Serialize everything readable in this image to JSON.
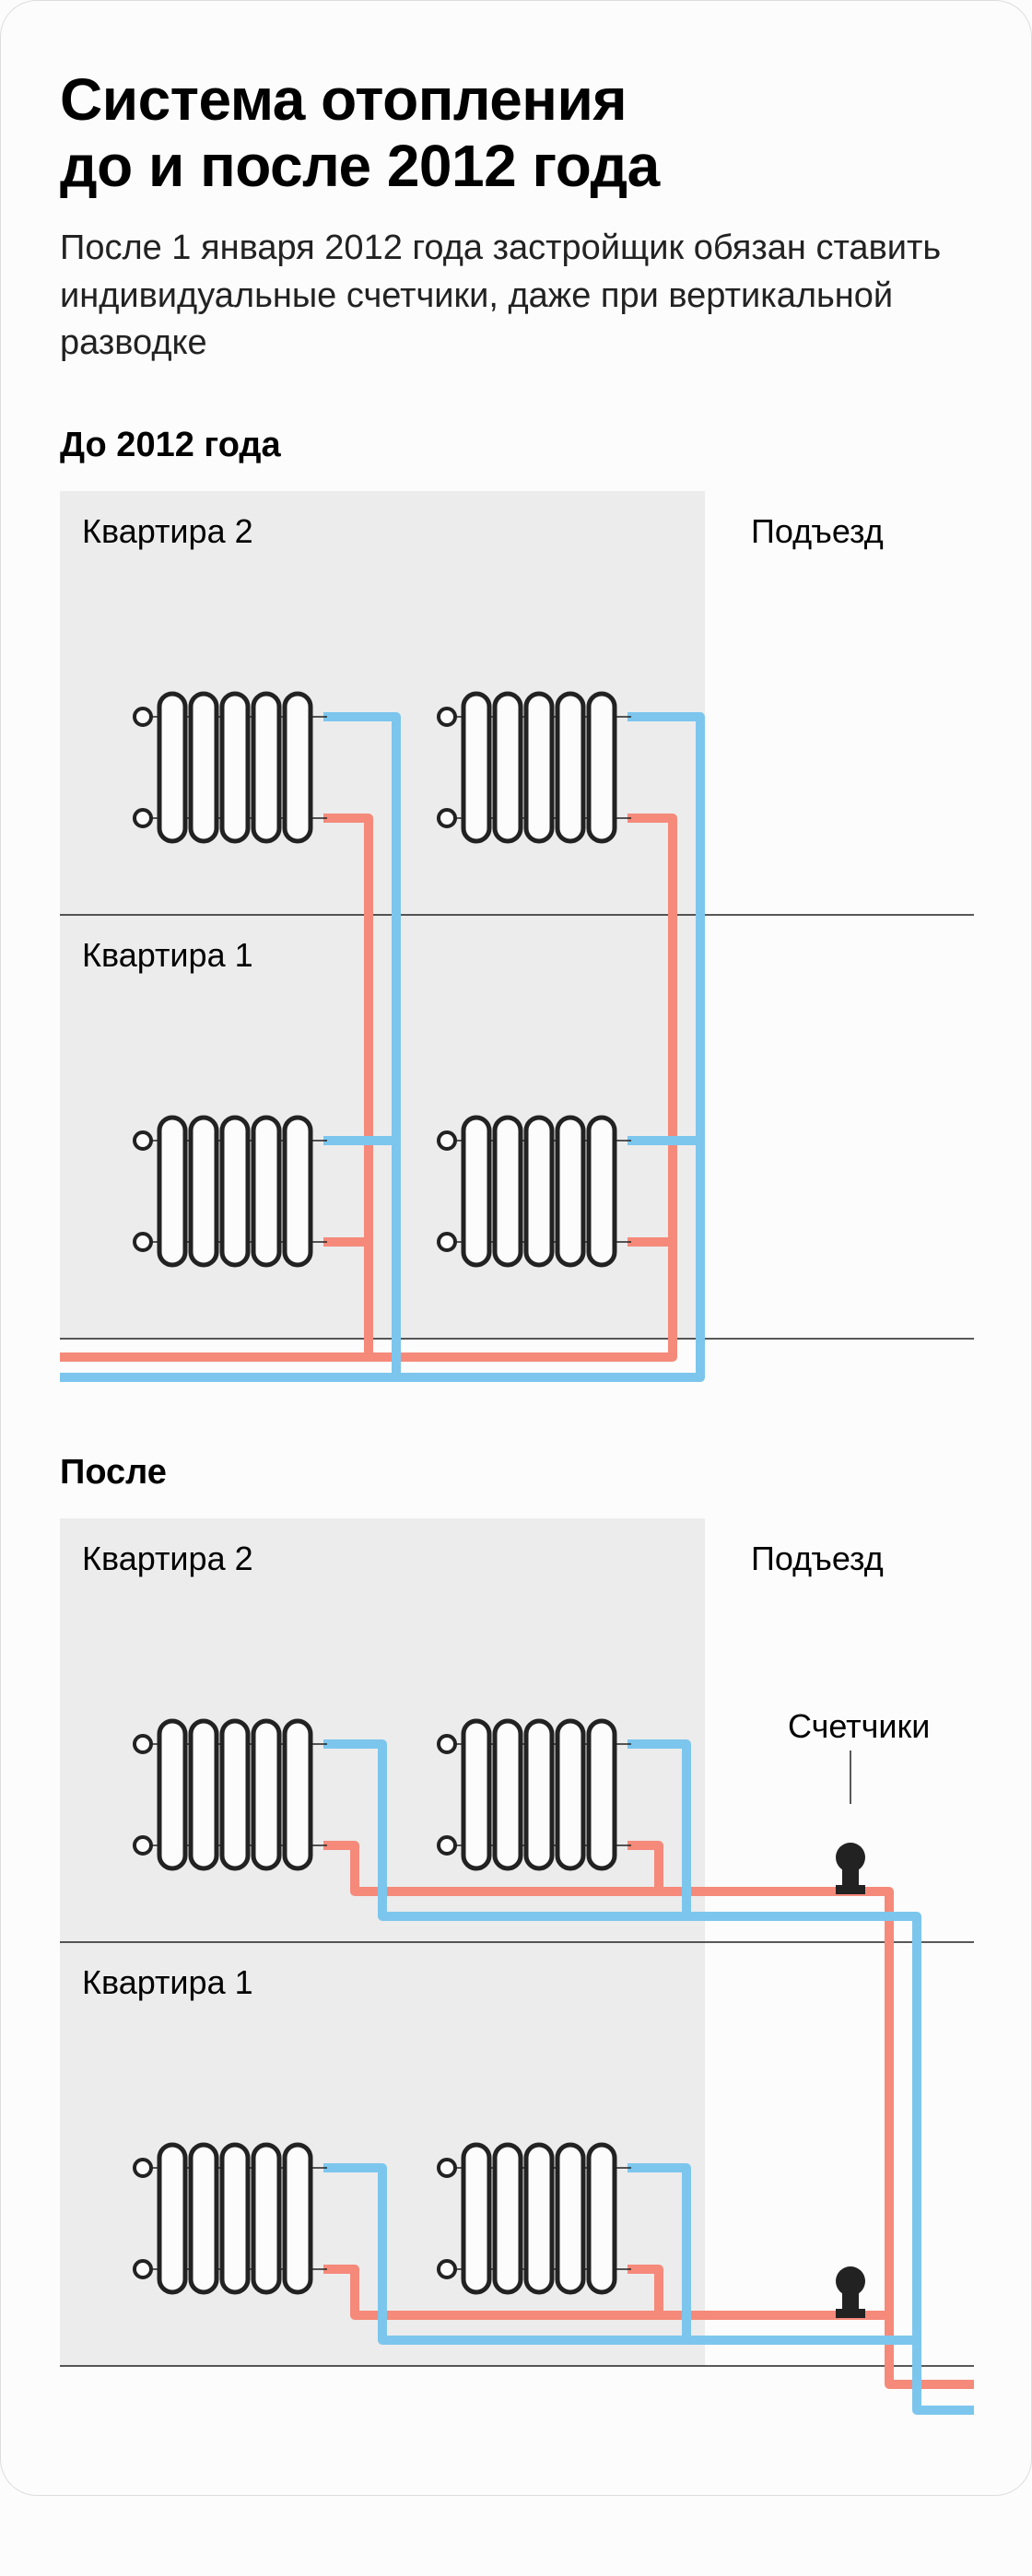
{
  "title_line1": "Система отопления",
  "title_line2": "до и после 2012 года",
  "subtitle": "После 1 января 2012 года застройщик обязан ставить индивидуальные счетчики, даже при вертикальной разводке",
  "before": {
    "heading": "До 2012 года",
    "apartment2": "Квартира 2",
    "apartment1": "Квартира 1",
    "entrance": "Подъезд"
  },
  "after": {
    "heading": "После",
    "apartment2": "Квартира 2",
    "apartment1": "Квартира 1",
    "entrance": "Подъезд",
    "meters": "Счетчики"
  },
  "colors": {
    "hot": "#f58a7a",
    "cold": "#7cc6ee",
    "box": "#ececec"
  }
}
